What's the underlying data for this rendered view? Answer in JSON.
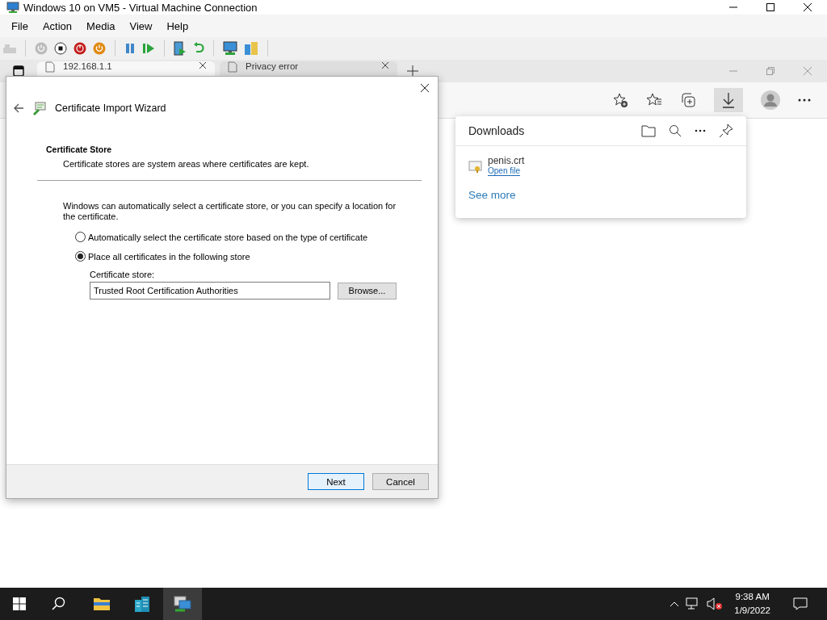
{
  "window": {
    "title": "Windows 10 on VM5 - Virtual Machine Connection"
  },
  "menu": [
    "File",
    "Action",
    "Media",
    "View",
    "Help"
  ],
  "browser": {
    "tabs": [
      {
        "label": "192.168.1.1",
        "selected": true
      },
      {
        "label": "Privacy error",
        "selected": false
      }
    ]
  },
  "downloads": {
    "title": "Downloads",
    "items": [
      {
        "name": "penis.crt",
        "action": "Open file"
      }
    ],
    "see_more": "See more"
  },
  "wizard": {
    "title": "Certificate Import Wizard",
    "heading": "Certificate Store",
    "subheading": "Certificate stores are system areas where certificates are kept.",
    "intro": "Windows can automatically select a certificate store, or you can specify a location for the certificate.",
    "options": [
      {
        "label": "Automatically select the certificate store based on the type of certificate",
        "selected": false
      },
      {
        "label": "Place all certificates in the following store",
        "selected": true
      }
    ],
    "store_label": "Certificate store:",
    "store_value": "Trusted Root Certification Authorities",
    "browse": "Browse...",
    "buttons": [
      {
        "label": "Next",
        "default": true
      },
      {
        "label": "Cancel",
        "default": false
      }
    ]
  },
  "taskbar": {
    "time": "9:38 AM",
    "date": "1/9/2022"
  }
}
